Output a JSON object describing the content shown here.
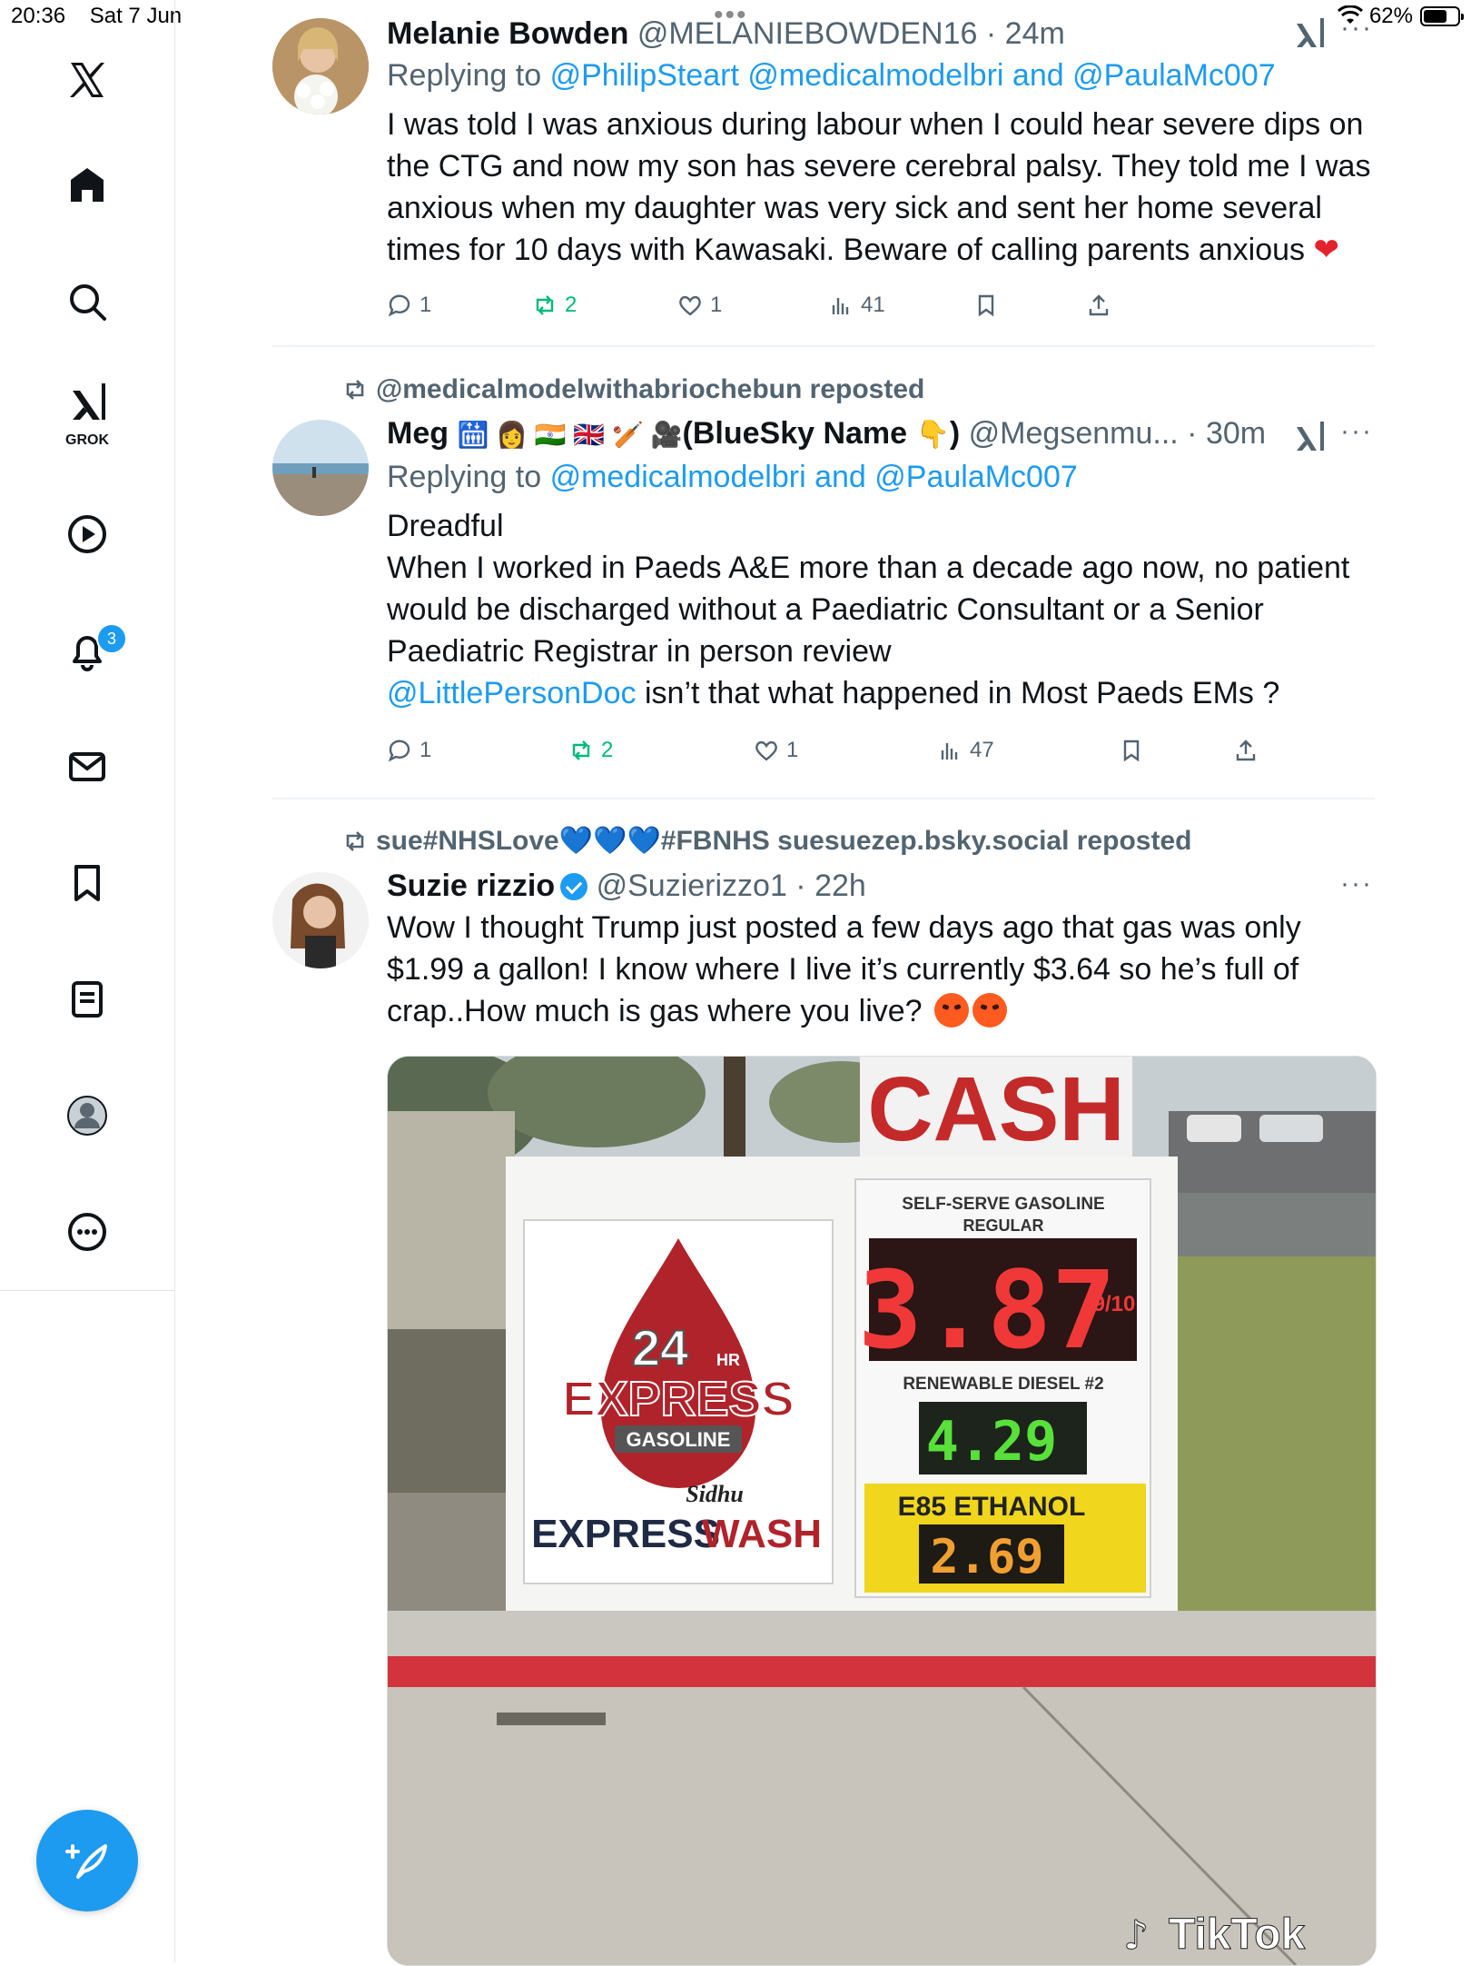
{
  "status_bar": {
    "time": "20:36",
    "date": "Sat 7 Jun",
    "battery": "62%",
    "battery_level": 0.62
  },
  "sidebar": {
    "items": [
      {
        "name": "x-logo-icon"
      },
      {
        "name": "home-icon"
      },
      {
        "name": "search-icon"
      },
      {
        "name": "grok-icon",
        "label": "GROK"
      },
      {
        "name": "video-icon"
      },
      {
        "name": "notifications-icon",
        "badge": "3"
      },
      {
        "name": "messages-icon"
      },
      {
        "name": "bookmarks-icon"
      },
      {
        "name": "lists-icon"
      },
      {
        "name": "profile-icon"
      },
      {
        "name": "more-icon"
      }
    ],
    "compose_icon": "compose-icon"
  },
  "tweets": [
    {
      "name": "Melanie Bowden",
      "handle": "@MELANIEBOWDEN16",
      "time": "24m",
      "replying_label": "Replying to",
      "replying": [
        "@PhilipSteart",
        "@medicalmodelbri",
        "and",
        "@PaulaMc007"
      ],
      "text": "I was told I was anxious during labour when I could hear severe  dips on the CTG and now my son has severe cerebral palsy. They told me I was anxious when my daughter was very sick and sent her home several times for 10 days with Kawasaki. Beware of calling parents anxious",
      "replies": "1",
      "reposts": "2",
      "likes": "1",
      "views": "41"
    },
    {
      "repost_by": "@medicalmodelwithabriochebun reposted",
      "name": "Meg",
      "name_extra": "(BlueSky Name",
      "name_close": ")",
      "handle": "@Megsenmu...",
      "time": "30m",
      "replying_label": "Replying to",
      "replying": [
        "@medicalmodelbri",
        "and",
        "@PaulaMc007"
      ],
      "text_lines": [
        "Dreadful",
        "When I worked in Paeds A&E more than a decade ago now, no patient would be discharged without a Paediatric Consultant or a Senior Paediatric Registrar in person review"
      ],
      "mention": "@LittlePersonDoc",
      "mention_tail": "isn’t that what happened in Most Paeds EMs ?",
      "replies": "1",
      "reposts": "2",
      "likes": "1",
      "views": "47"
    },
    {
      "repost_by": "sue#NHSLove💙💙💙#FBNHS suesuezep.bsky.social reposted",
      "name": "Suzie rizzio",
      "handle": "@Suzierizzo1",
      "time": "22h",
      "text": "Wow I thought Trump just posted a few days ago that gas was only $1.99 a gallon! I know where I live it’s currently $3.64 so he’s full of crap..How much is gas where you live?",
      "media": {
        "cash_sign": "CASH",
        "brand_top": "24",
        "brand_hr": "HR",
        "brand_express": "EXPRESS",
        "brand_gasoline": "GASOLINE",
        "brand_sidhu": "Sidhu",
        "brand_wash_a": "EXPRESS",
        "brand_wash_b": "WASH",
        "label_gasoline": "SELF-SERVE GASOLINE",
        "label_regular": "REGULAR",
        "price_regular": "3.87",
        "label_diesel": "RENEWABLE DIESEL #2",
        "price_diesel": "4.29",
        "label_e85": "E85 ETHANOL",
        "price_e85": "2.69",
        "fraction": "9/10",
        "watermark": "TikTok"
      }
    }
  ],
  "colors": {
    "accent": "#1d9bf0",
    "repost_green": "#00ba7c",
    "muted": "#536471",
    "text": "#0f1419"
  }
}
